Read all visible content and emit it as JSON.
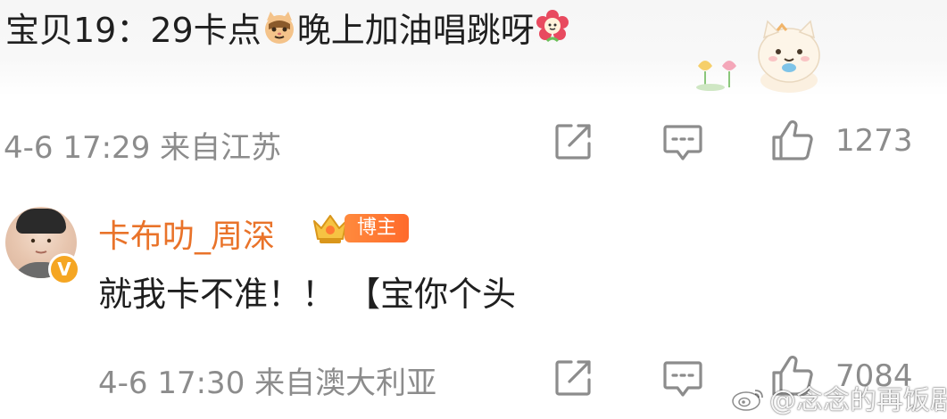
{
  "comment1": {
    "text_before": "宝贝19：29卡点",
    "text_after": "晚上加油唱跳呀",
    "emoji_1": "cat-emoji",
    "emoji_2": "flower-emoji",
    "sticker": "cat-sticker",
    "date": "4-6 17:29",
    "location": "来自江苏",
    "like_count": "1273"
  },
  "reply": {
    "username": "卡布叻_周深",
    "badge_label": "博主",
    "verify_mark": "V",
    "text": "就我卡不准！！ 【宝你个头",
    "date": "4-6 17:30",
    "location": "来自澳大利亚",
    "like_count": "7084"
  },
  "watermark": {
    "text": "@念念的再饭剧"
  },
  "colors": {
    "username": "#e9732a",
    "meta_gray": "#8c8c8c",
    "badge_orange": "#ff7a33",
    "verify_yellow": "#f5a623"
  }
}
